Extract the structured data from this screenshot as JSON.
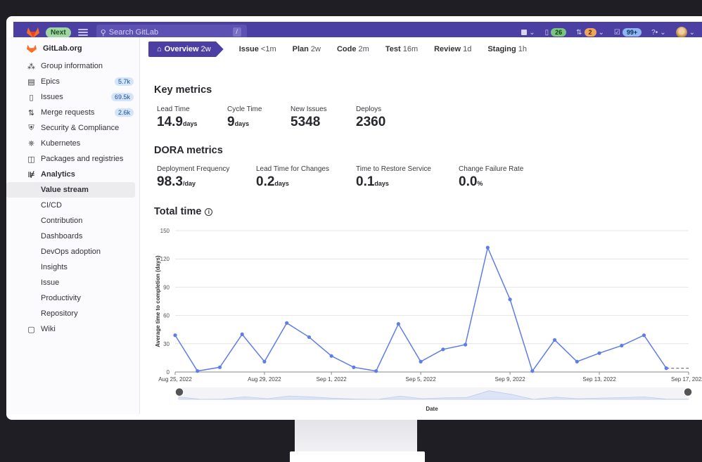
{
  "header": {
    "next_label": "Next",
    "search_placeholder": "Search GitLab",
    "search_shortcut": "/",
    "issues_count": "26",
    "merge_requests_count": "2",
    "todos_count": "99+"
  },
  "sidebar": {
    "org_name": "GitLab.org",
    "items": [
      {
        "label": "Group information",
        "icon": "group-icon"
      },
      {
        "label": "Epics",
        "icon": "epic-icon",
        "count": "5.7k"
      },
      {
        "label": "Issues",
        "icon": "issues-icon",
        "count": "69.5k"
      },
      {
        "label": "Merge requests",
        "icon": "merge-request-icon",
        "count": "2.6k"
      },
      {
        "label": "Security & Compliance",
        "icon": "shield-icon"
      },
      {
        "label": "Kubernetes",
        "icon": "kubernetes-icon"
      },
      {
        "label": "Packages and registries",
        "icon": "package-icon"
      },
      {
        "label": "Analytics",
        "icon": "analytics-icon"
      }
    ],
    "analytics_sub": [
      "Value stream",
      "CI/CD",
      "Contribution",
      "Dashboards",
      "DevOps adoption",
      "Insights",
      "Issue",
      "Productivity",
      "Repository"
    ],
    "wiki_label": "Wiki"
  },
  "stages": [
    {
      "name": "Overview",
      "duration": "2w"
    },
    {
      "name": "Issue",
      "duration": "<1m"
    },
    {
      "name": "Plan",
      "duration": "2w"
    },
    {
      "name": "Code",
      "duration": "2m"
    },
    {
      "name": "Test",
      "duration": "16m"
    },
    {
      "name": "Review",
      "duration": "1d"
    },
    {
      "name": "Staging",
      "duration": "1h"
    }
  ],
  "key_metrics": {
    "title": "Key metrics",
    "items": [
      {
        "label": "Lead Time",
        "value": "14.9",
        "unit": "days"
      },
      {
        "label": "Cycle Time",
        "value": "9",
        "unit": "days"
      },
      {
        "label": "New Issues",
        "value": "5348",
        "unit": ""
      },
      {
        "label": "Deploys",
        "value": "2360",
        "unit": ""
      }
    ]
  },
  "dora_metrics": {
    "title": "DORA metrics",
    "items": [
      {
        "label": "Deployment Frequency",
        "value": "98.3",
        "unit": "/day"
      },
      {
        "label": "Lead Time for Changes",
        "value": "0.2",
        "unit": "days"
      },
      {
        "label": "Time to Restore Service",
        "value": "0.1",
        "unit": "days"
      },
      {
        "label": "Change Failure Rate",
        "value": "0.0",
        "unit": "%"
      }
    ]
  },
  "total_time_title": "Total time",
  "chart_data": {
    "type": "line",
    "title": "Total time",
    "xlabel": "Date",
    "ylabel": "Average time to completion (days)",
    "ylim": [
      0,
      150
    ],
    "yticks": [
      0,
      30,
      60,
      90,
      120,
      150
    ],
    "grid": true,
    "x": [
      "Aug 25, 2022",
      "Aug 26, 2022",
      "Aug 27, 2022",
      "Aug 28, 2022",
      "Aug 29, 2022",
      "Aug 30, 2022",
      "Aug 31, 2022",
      "Sep 1, 2022",
      "Sep 2, 2022",
      "Sep 3, 2022",
      "Sep 4, 2022",
      "Sep 5, 2022",
      "Sep 6, 2022",
      "Sep 7, 2022",
      "Sep 8, 2022",
      "Sep 9, 2022",
      "Sep 10, 2022",
      "Sep 11, 2022",
      "Sep 12, 2022",
      "Sep 13, 2022",
      "Sep 14, 2022",
      "Sep 15, 2022",
      "Sep 16, 2022",
      "Sep 17, 2022"
    ],
    "x_tick_labels": [
      "Aug 25, 2022",
      "Aug 29, 2022",
      "Sep 1, 2022",
      "Sep 5, 2022",
      "Sep 9, 2022",
      "Sep 13, 2022",
      "Sep 17, 2022"
    ],
    "series": [
      {
        "values": [
          39,
          1,
          5,
          40,
          11,
          52,
          37,
          17,
          5,
          1,
          51,
          11,
          24,
          29,
          132,
          77,
          1,
          34,
          11,
          20,
          28,
          39,
          4,
          4
        ],
        "color": "#5f7de7"
      }
    ]
  }
}
